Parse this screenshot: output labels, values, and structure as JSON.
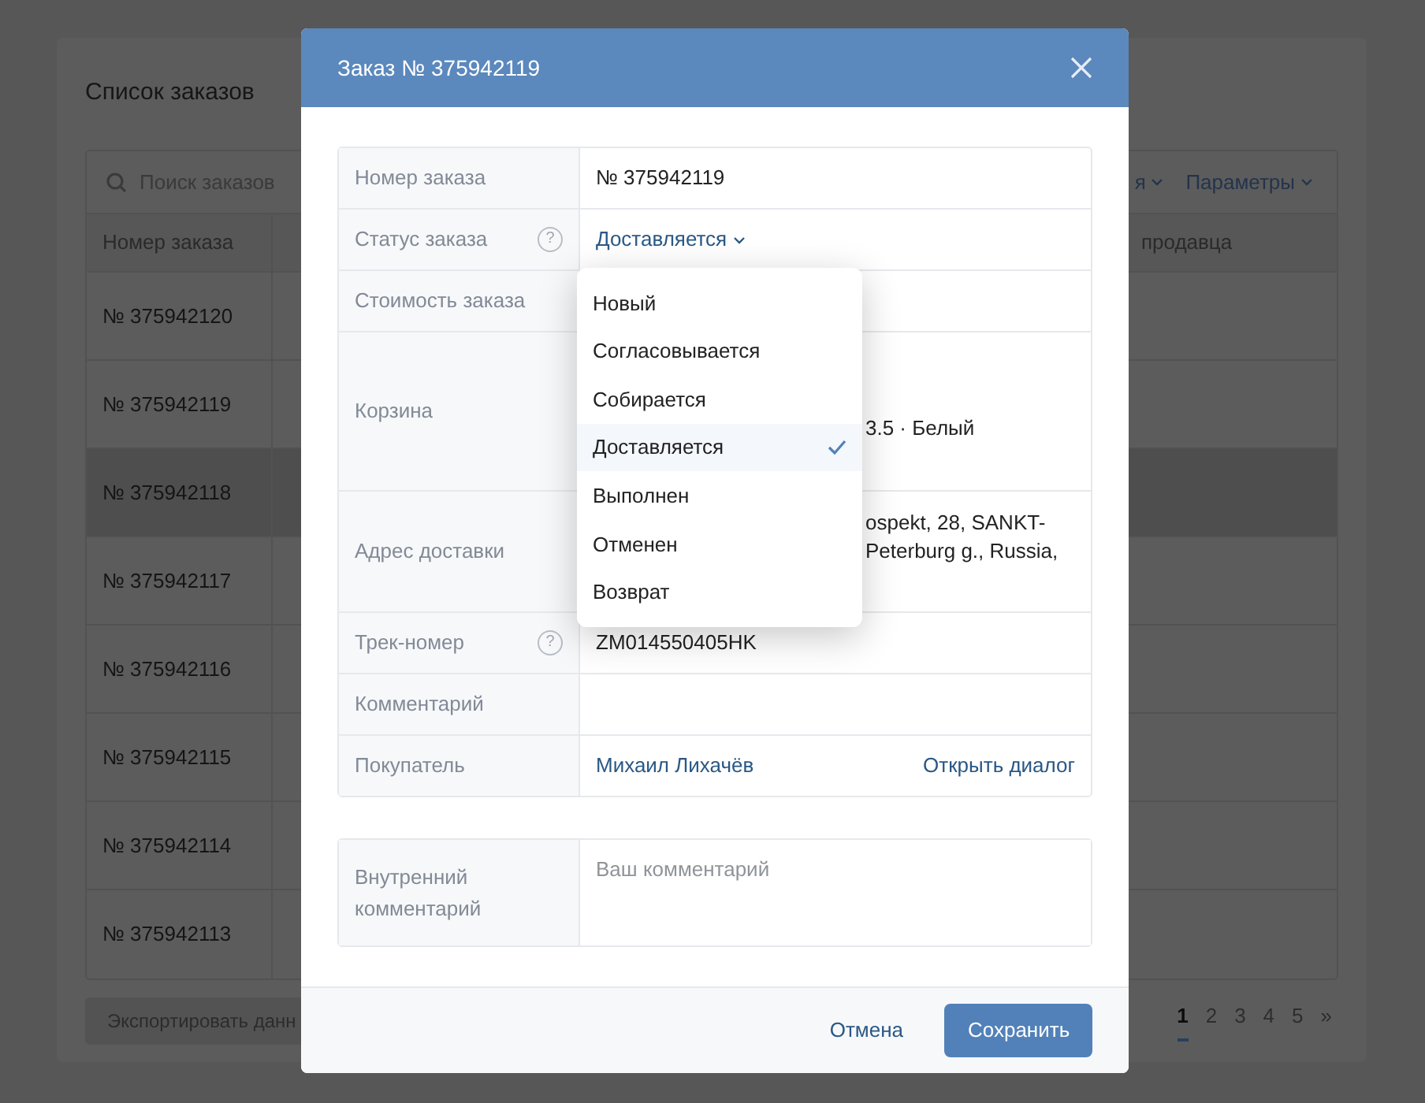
{
  "page": {
    "title": "Список заказов",
    "search": {
      "placeholder": "Поиск заказов"
    },
    "toolbar_links": [
      {
        "label": "я"
      },
      {
        "label": "Параметры"
      }
    ],
    "table": {
      "columns": [
        "Номер заказа",
        "продавца"
      ],
      "rows": [
        {
          "order": "№ 375942120",
          "selected": false
        },
        {
          "order": "№ 375942119",
          "selected": false
        },
        {
          "order": "№ 375942118",
          "selected": true
        },
        {
          "order": "№ 375942117",
          "selected": false
        },
        {
          "order": "№ 375942116",
          "selected": false
        },
        {
          "order": "№ 375942115",
          "selected": false
        },
        {
          "order": "№ 375942114",
          "selected": false
        },
        {
          "order": "№ 375942113",
          "selected": false
        }
      ]
    },
    "export_button": "Экспортировать данн",
    "pagination": [
      {
        "label": "1",
        "selected": true
      },
      {
        "label": "2",
        "selected": false
      },
      {
        "label": "3",
        "selected": false
      },
      {
        "label": "4",
        "selected": false
      },
      {
        "label": "5",
        "selected": false
      },
      {
        "label": "»",
        "selected": false
      }
    ]
  },
  "modal": {
    "title": "Заказ № 375942119",
    "fields": [
      {
        "kind": "text",
        "label": "Номер заказа",
        "lines": [
          "№ 375942119"
        ]
      },
      {
        "kind": "status",
        "label": "Статус заказа",
        "help": "?",
        "value": "Доставляется"
      },
      {
        "kind": "text",
        "label": "Стоимость заказа"
      },
      {
        "kind": "cut",
        "label": "Корзина",
        "lines": [
          "3.5 · Белый"
        ]
      },
      {
        "kind": "cut",
        "label": "Адрес доставки",
        "lines": [
          "ospekt, 28, SANKT-",
          "Peterburg g., Russia,"
        ]
      },
      {
        "kind": "text",
        "label": "Трек-номер",
        "help": "?",
        "lines": [
          "ZM014550405HK"
        ]
      },
      {
        "kind": "text",
        "label": "Комментарий"
      },
      {
        "kind": "person",
        "label": "Покупатель",
        "value": "Михаил Лихачёв",
        "action": "Открыть диалог"
      }
    ],
    "internal_comment": {
      "label": "Внутренний комментарий",
      "placeholder": "Ваш комментарий"
    },
    "status_menu": [
      {
        "label": "Новый",
        "selected": false
      },
      {
        "label": "Согласовывается",
        "selected": false
      },
      {
        "label": "Собирается",
        "selected": false
      },
      {
        "label": "Доставляется",
        "selected": true
      },
      {
        "label": "Выполнен",
        "selected": false
      },
      {
        "label": "Отменен",
        "selected": false
      },
      {
        "label": "Возврат",
        "selected": false
      }
    ],
    "buttons": [
      {
        "kind": "secondary",
        "label": "Отмена"
      },
      {
        "kind": "primary",
        "label": "Сохранить"
      }
    ]
  }
}
